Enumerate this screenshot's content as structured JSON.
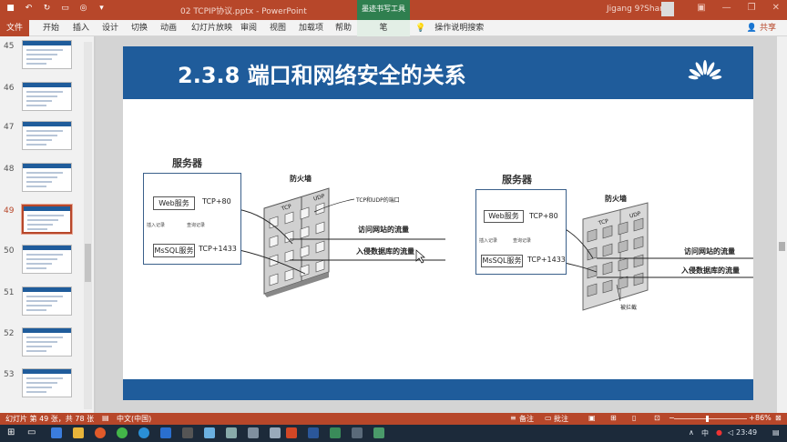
{
  "titlebar": {
    "document_title": "02 TCPIP协议.pptx  -  PowerPoint",
    "context_tools": "墨迹书写工具",
    "user_name": "Jigang 9?Shan"
  },
  "ribbon": {
    "tabs": [
      "文件",
      "开始",
      "插入",
      "设计",
      "切换",
      "动画",
      "幻灯片放映",
      "审阅",
      "视图",
      "加载项",
      "帮助",
      "笔"
    ],
    "search": "操作说明搜索",
    "share": "共享"
  },
  "thumbnails": [
    {
      "num": "45"
    },
    {
      "num": "46"
    },
    {
      "num": "47"
    },
    {
      "num": "48"
    },
    {
      "num": "49",
      "active": true
    },
    {
      "num": "50"
    },
    {
      "num": "51"
    },
    {
      "num": "52"
    },
    {
      "num": "53"
    }
  ],
  "slide": {
    "title": "2.3.8  端口和网络安全的关系",
    "left": {
      "server": "服务器",
      "web": "Web服务",
      "sql": "MsSQL服务",
      "port_web": "TCP+80",
      "port_sql": "TCP+1433",
      "insert_note": "插入记录",
      "query_note": "查询记录",
      "firewall": "防火墙",
      "tcp": "TCP",
      "udp": "UDP",
      "port_note": "TCP和UDP的端口",
      "flow_web": "访问网站的流量",
      "flow_attack": "入侵数据库的流量"
    },
    "right": {
      "server": "服务器",
      "web": "Web服务",
      "sql": "MsSQL服务",
      "port_web": "TCP+80",
      "port_sql": "TCP+1433",
      "insert_note": "插入记录",
      "query_note": "查询记录",
      "firewall": "防火墙",
      "tcp": "TCP",
      "udp": "UDP",
      "blocked": "被拦截",
      "flow_web": "访问网站的流量",
      "flow_attack": "入侵数据库的流量"
    }
  },
  "status": {
    "slide_info": "幻灯片 第 49 张，共 78 张",
    "language": "中文(中国)",
    "notes": "备注",
    "comments": "批注",
    "zoom": "86%"
  },
  "taskbar": {
    "ime": "中",
    "time": "23:49"
  },
  "colors": {
    "ppt_accent": "#b7472a",
    "slide_blue": "#1f5c9b",
    "pen_tools": "#2f7f4f"
  }
}
